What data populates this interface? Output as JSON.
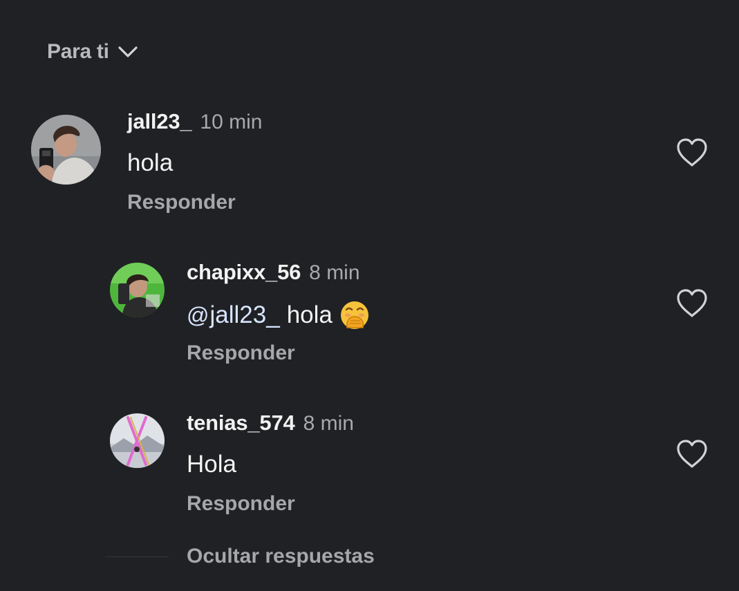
{
  "header": {
    "filter_label": "Para ti",
    "filter_icon": "chevron-down-icon"
  },
  "comments": [
    {
      "username": "jall23_",
      "time": "10 min",
      "text": "hola",
      "reply_label": "Responder",
      "like_icon": "heart-outline-icon"
    },
    {
      "username": "chapixx_56",
      "time": "8 min",
      "mention": "jall23_",
      "text": "hola",
      "emoji": "face-with-hand-over-mouth",
      "reply_label": "Responder",
      "like_icon": "heart-outline-icon"
    },
    {
      "username": "tenias_574",
      "time": "8 min",
      "text": "Hola",
      "reply_label": "Responder",
      "like_icon": "heart-outline-icon"
    }
  ],
  "hide_replies_label": "Ocultar respuestas",
  "colors": {
    "background": "#202124",
    "text_primary": "#f2f2f2",
    "text_secondary": "#a6a7a9",
    "mention": "#d8e6ff"
  }
}
